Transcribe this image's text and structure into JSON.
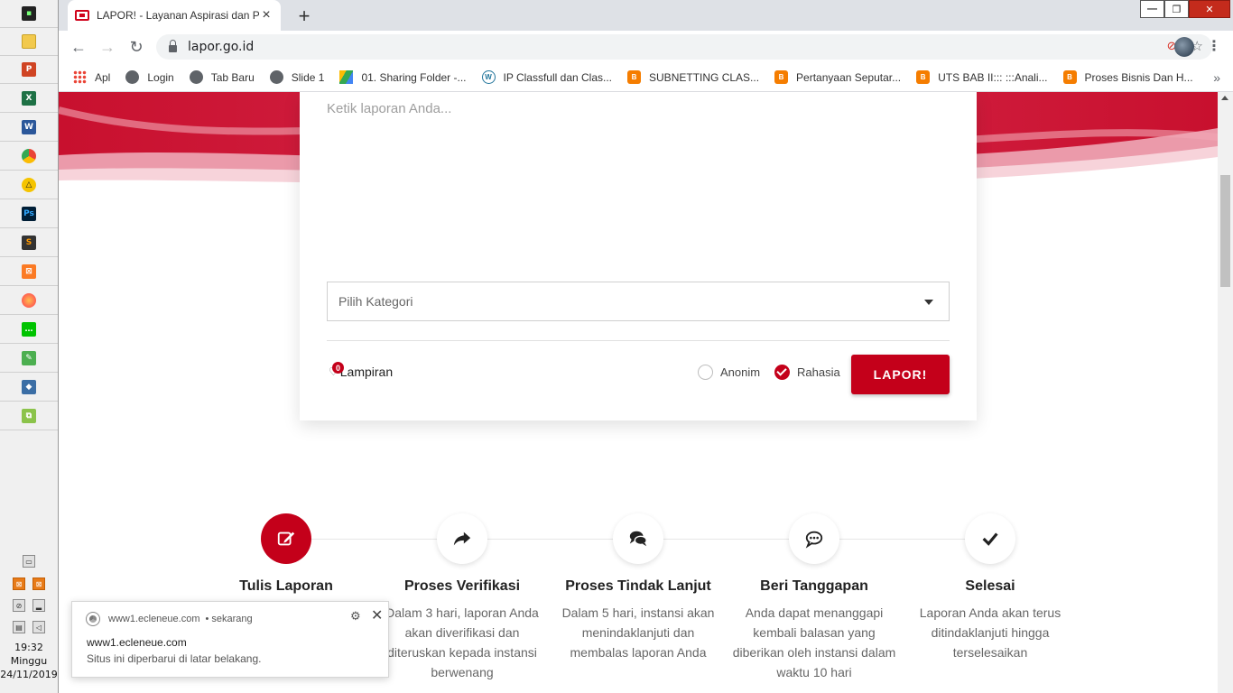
{
  "browser": {
    "tab_title": "LAPOR! - Layanan Aspirasi dan Pengaduan",
    "new_tab_symbol": "+",
    "url": "lapor.go.id",
    "bookmarks": [
      {
        "label": "Apl",
        "icon": "apps-grid-icon"
      },
      {
        "label": "Login",
        "icon": "globe-icon"
      },
      {
        "label": "Tab Baru",
        "icon": "globe-icon"
      },
      {
        "label": "Slide 1",
        "icon": "globe-icon"
      },
      {
        "label": "01. Sharing Folder -...",
        "icon": "google-drive-icon"
      },
      {
        "label": "IP Classfull dan Clas...",
        "icon": "wordpress-icon"
      },
      {
        "label": "SUBNETTING CLAS...",
        "icon": "blogger-icon"
      },
      {
        "label": "Pertanyaan Seputar...",
        "icon": "blogger-icon"
      },
      {
        "label": "UTS BAB II::: :::Anali...",
        "icon": "blogger-icon"
      },
      {
        "label": "Proses Bisnis Dan H...",
        "icon": "blogger-icon"
      }
    ],
    "more_symbol": "»"
  },
  "form": {
    "report_placeholder": "Ketik laporan Anda...",
    "category_placeholder": "Pilih Kategori",
    "attachment_label": "Lampiran",
    "attachment_count": "0",
    "anonim_label": "Anonim",
    "rahasia_label": "Rahasia",
    "submit_label": "LAPOR!"
  },
  "steps": [
    {
      "title": "Tulis Laporan",
      "desc": "",
      "icon": "edit-icon"
    },
    {
      "title": "Proses Verifikasi",
      "desc": "Dalam 3 hari, laporan Anda akan diverifikasi dan diteruskan kepada instansi berwenang",
      "icon": "share-arrow-icon"
    },
    {
      "title": "Proses Tindak Lanjut",
      "desc": "Dalam 5 hari, instansi akan menindaklanjuti dan membalas laporan Anda",
      "icon": "comments-icon"
    },
    {
      "title": "Beri Tanggapan",
      "desc": "Anda dapat menanggapi kembali balasan yang diberikan oleh instansi dalam waktu 10 hari",
      "icon": "comment-dots-icon"
    },
    {
      "title": "Selesai",
      "desc": "Laporan Anda akan terus ditindaklanjuti hingga terselesaikan",
      "icon": "checkmark-icon"
    }
  ],
  "notification": {
    "source": "www1.ecleneue.com",
    "time": "• sekarang",
    "title": "www1.ecleneue.com",
    "body": "Situs ini diperbarui di latar belakang."
  },
  "clock": {
    "time": "19:32",
    "day": "Minggu",
    "date": "24/11/2019"
  },
  "colors": {
    "brand_red": "#c4001a"
  }
}
